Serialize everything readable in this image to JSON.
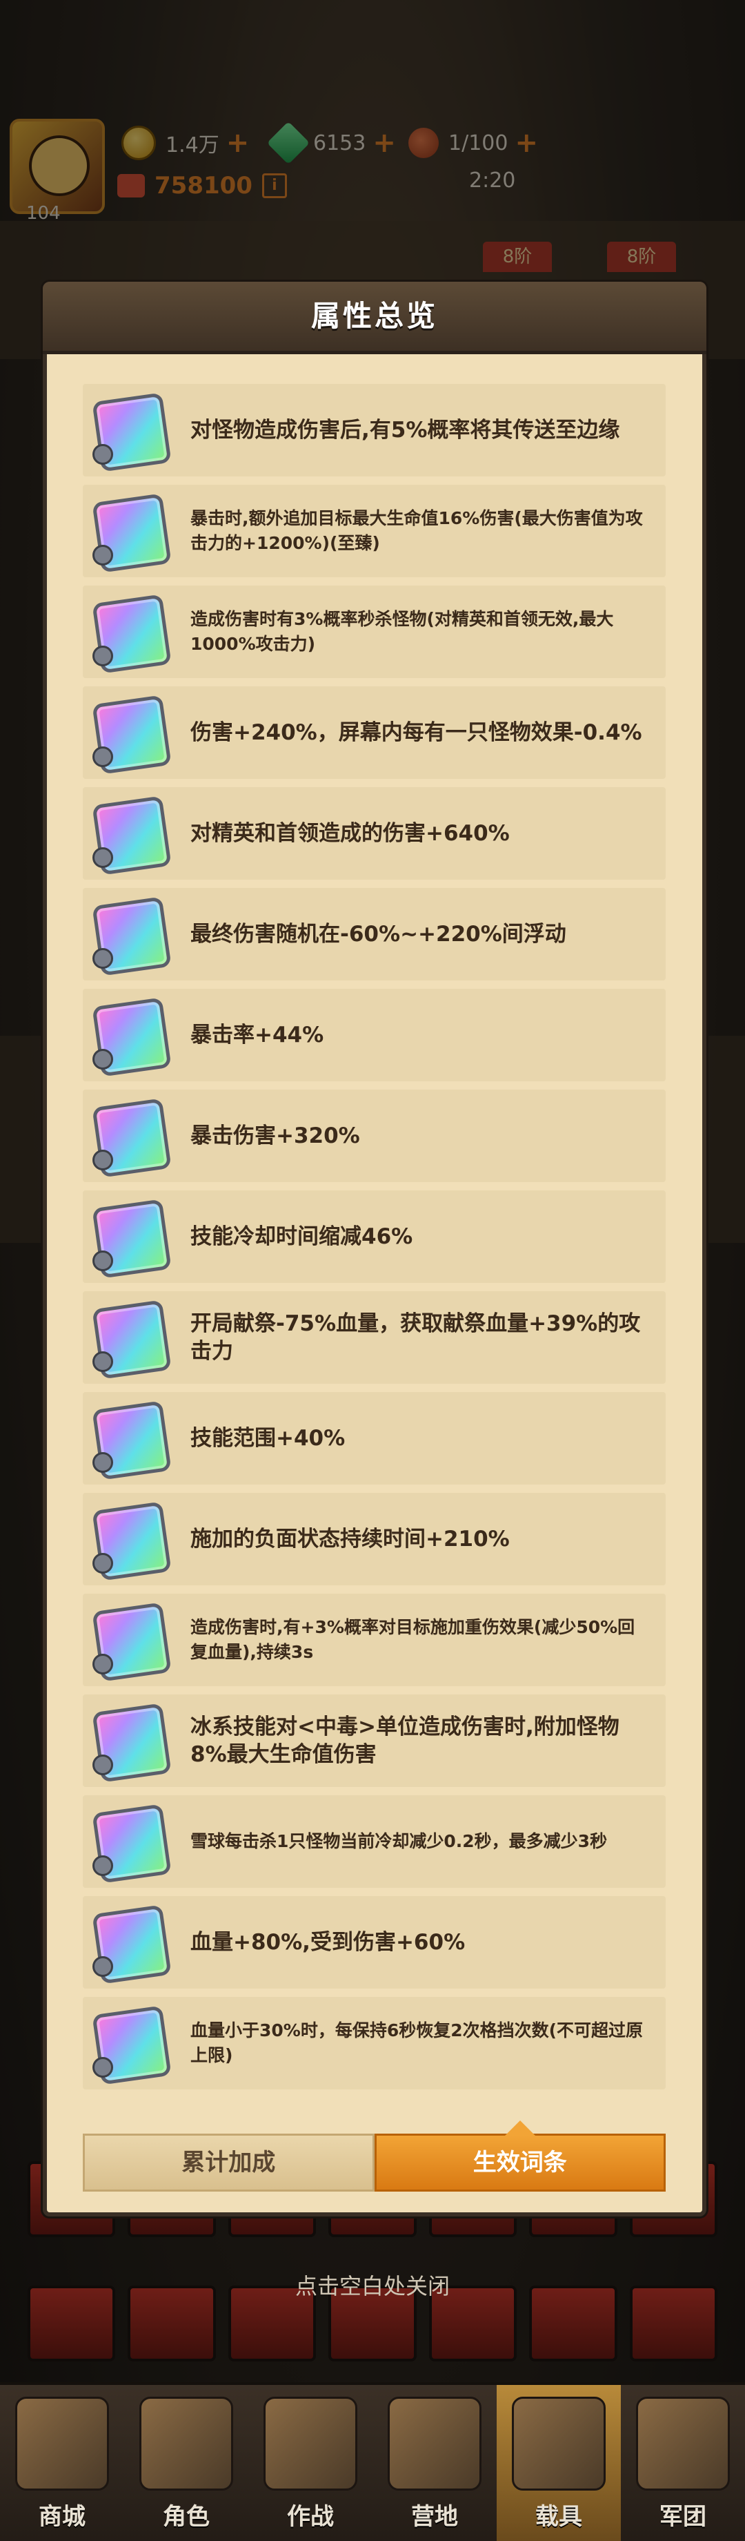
{
  "header": {
    "level": "104",
    "coins": "1.4万",
    "gems": "6153",
    "stamina": "1/100",
    "power": "758100",
    "power_info": "i",
    "timer": "2:20",
    "plus": "+"
  },
  "side_tags": [
    "8阶",
    "8阶"
  ],
  "modal": {
    "title": "属性总览",
    "items": [
      {
        "text": "对怪物造成伤害后,有5%概率将其传送至边缘",
        "size": "lg"
      },
      {
        "text": "暴击时,额外追加目标最大生命值16%伤害(最大伤害值为攻击力的+1200%)(至臻)",
        "size": "sm"
      },
      {
        "text": "造成伤害时有3%概率秒杀怪物(对精英和首领无效,最大1000%攻击力)",
        "size": "sm"
      },
      {
        "text": "伤害+240%，屏幕内每有一只怪物效果-0.4%",
        "size": "lg"
      },
      {
        "text": "对精英和首领造成的伤害+640%",
        "size": "lg"
      },
      {
        "text": "最终伤害随机在-60%~+220%间浮动",
        "size": "lg"
      },
      {
        "text": "暴击率+44%",
        "size": "lg"
      },
      {
        "text": "暴击伤害+320%",
        "size": "lg"
      },
      {
        "text": "技能冷却时间缩减46%",
        "size": "lg"
      },
      {
        "text": "开局献祭-75%血量，获取献祭血量+39%的攻击力",
        "size": "lg"
      },
      {
        "text": "技能范围+40%",
        "size": "lg"
      },
      {
        "text": "施加的负面状态持续时间+210%",
        "size": "lg"
      },
      {
        "text": "造成伤害时,有+3%概率对目标施加重伤效果(减少50%回复血量),持续3s",
        "size": "sm"
      },
      {
        "text": "冰系技能对<中毒>单位造成伤害时,附加怪物8%最大生命值伤害",
        "size": "lg"
      },
      {
        "text": "雪球每击杀1只怪物当前冷却减少0.2秒，最多减少3秒",
        "size": "sm"
      },
      {
        "text": "血量+80%,受到伤害+60%",
        "size": "lg"
      },
      {
        "text": "血量小于30%时，每保持6秒恢复2次格挡次数(不可超过原上限)",
        "size": "sm"
      }
    ],
    "tabs": [
      {
        "label": "累计加成",
        "active": false
      },
      {
        "label": "生效词条",
        "active": true
      }
    ]
  },
  "close_hint": "点击空白处关闭",
  "nav": [
    {
      "label": "商城",
      "icon": "shop-icon"
    },
    {
      "label": "角色",
      "icon": "character-icon"
    },
    {
      "label": "作战",
      "icon": "battle-icon"
    },
    {
      "label": "营地",
      "icon": "camp-icon"
    },
    {
      "label": "载具",
      "icon": "vehicle-icon",
      "active": true
    },
    {
      "label": "军团",
      "icon": "legion-icon"
    }
  ],
  "colors": {
    "accent": "#e0822b",
    "panel": "#f1dfb8",
    "item": "#e8d6ad",
    "tab_active": "#f2a436"
  }
}
